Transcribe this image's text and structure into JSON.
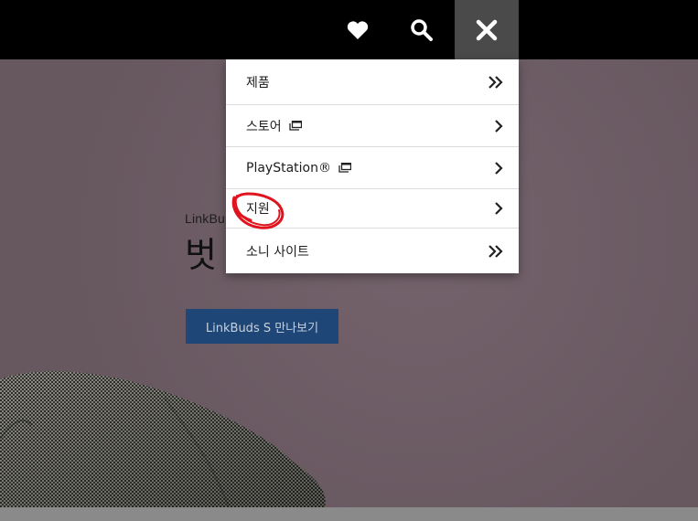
{
  "header": {
    "wishlist_icon": "heart-icon",
    "search_icon": "search-icon",
    "close_icon": "close-icon"
  },
  "menu": {
    "items": [
      {
        "label": "제품",
        "arrow": "double-chevron-right-icon",
        "external": false
      },
      {
        "label": "스토어",
        "arrow": "chevron-right-icon",
        "external": true
      },
      {
        "label": "PlayStation®",
        "arrow": "chevron-right-icon",
        "external": true
      },
      {
        "label": "지원",
        "arrow": "chevron-right-icon",
        "external": false
      },
      {
        "label": "소니 사이트",
        "arrow": "double-chevron-right-icon",
        "external": false
      }
    ]
  },
  "hero": {
    "eyebrow": "LinkBu",
    "title": "벗",
    "cta_label": "LinkBuds S 만나보기"
  },
  "colors": {
    "topbar": "#000000",
    "hero_bg": "#6b5a63",
    "cta_bg": "#1e4676",
    "annotation": "#e0141e"
  }
}
